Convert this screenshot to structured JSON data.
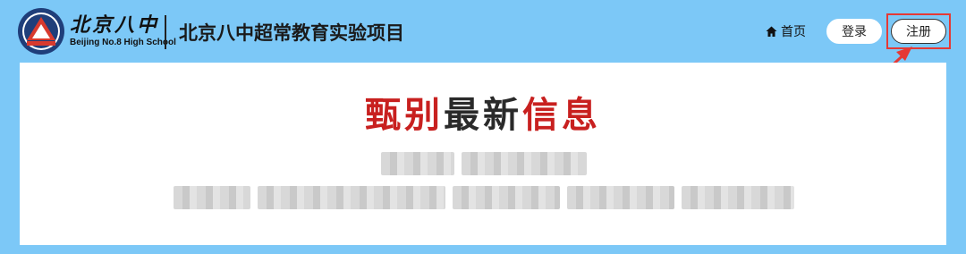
{
  "logo": {
    "cn": "北京八中",
    "en": "Beijing No.8 High School"
  },
  "header": {
    "title": "北京八中超常教育实验项目"
  },
  "nav": {
    "home_label": "首页",
    "home_icon": "home-icon",
    "login_label": "登录",
    "register_label": "注册"
  },
  "headline": {
    "part1": "甄别",
    "part2": "最新",
    "part3": "信息"
  },
  "colors": {
    "background": "#7cc8f7",
    "headline_red": "#c8201f",
    "highlight": "#e53935"
  }
}
